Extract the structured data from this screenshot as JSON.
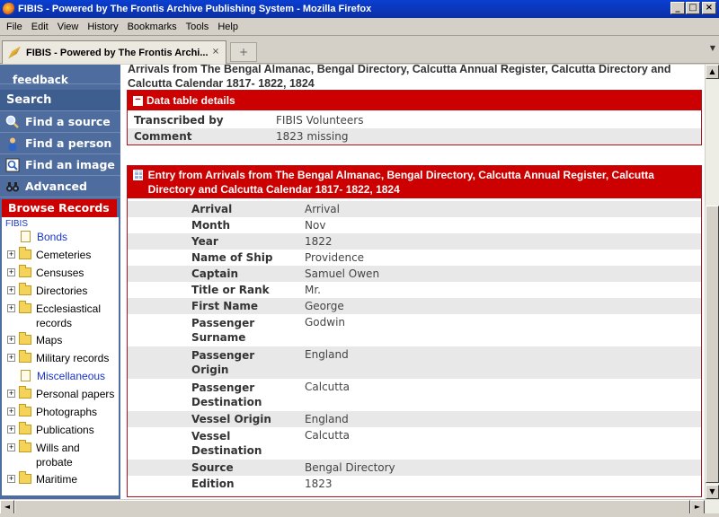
{
  "window": {
    "title": "FIBIS - Powered by The Frontis Archive Publishing System - Mozilla Firefox",
    "minimize": "_",
    "maximize": "□",
    "close": "×"
  },
  "menu": [
    "File",
    "Edit",
    "View",
    "History",
    "Bookmarks",
    "Tools",
    "Help"
  ],
  "tab": {
    "label": "FIBIS - Powered by The Frontis Archi...",
    "close": "×",
    "new_tab": "+"
  },
  "sidebar": {
    "top_item": "feedback",
    "search_head": "Search",
    "items": [
      {
        "label": "Find a source",
        "icon": "magnifier-icon"
      },
      {
        "label": "Find a person",
        "icon": "person-icon"
      },
      {
        "label": "Find an image",
        "icon": "image-icon"
      },
      {
        "label": "Advanced",
        "icon": "binoculars-icon"
      }
    ],
    "browse_head": "Browse Records",
    "tree_root": "FIBIS",
    "tree": [
      {
        "label": "Bonds",
        "type": "doc"
      },
      {
        "label": "Cemeteries",
        "type": "folder"
      },
      {
        "label": "Censuses",
        "type": "folder"
      },
      {
        "label": "Directories",
        "type": "folder"
      },
      {
        "label": "Ecclesiastical records",
        "type": "folder"
      },
      {
        "label": "Maps",
        "type": "folder"
      },
      {
        "label": "Military records",
        "type": "folder"
      },
      {
        "label": "Miscellaneous",
        "type": "doc"
      },
      {
        "label": "Personal papers",
        "type": "folder"
      },
      {
        "label": "Photographs",
        "type": "folder"
      },
      {
        "label": "Publications",
        "type": "folder"
      },
      {
        "label": "Wills and probate",
        "type": "folder"
      },
      {
        "label": "Maritime",
        "type": "folder"
      }
    ]
  },
  "main": {
    "title": "Arrivals from The Bengal Almanac, Bengal Directory, Calcutta Annual Register, Calcutta Directory and Calcutta Calendar 1817- 1822, 1824",
    "details": {
      "head": "Data table details",
      "toggle": "−",
      "rows": [
        {
          "k": "Transcribed by",
          "v": "FIBIS Volunteers"
        },
        {
          "k": "Comment",
          "v": "1823 missing"
        }
      ]
    },
    "entry": {
      "head": "Entry from Arrivals from The Bengal Almanac, Bengal Directory, Calcutta Annual Register, Calcutta Directory and Calcutta Calendar 1817- 1822, 1824",
      "rows": [
        {
          "k": "Arrival",
          "v": "Arrival"
        },
        {
          "k": "Month",
          "v": "Nov"
        },
        {
          "k": "Year",
          "v": "1822"
        },
        {
          "k": "Name of Ship",
          "v": "Providence"
        },
        {
          "k": "Captain",
          "v": "Samuel Owen"
        },
        {
          "k": "Title or Rank",
          "v": "Mr."
        },
        {
          "k": "First Name",
          "v": "George"
        },
        {
          "k": "Passenger Surname",
          "v": "Godwin"
        },
        {
          "k": "Passenger Origin",
          "v": "England"
        },
        {
          "k": "Passenger Destination",
          "v": "Calcutta"
        },
        {
          "k": "Vessel Origin",
          "v": "England"
        },
        {
          "k": "Vessel Destination",
          "v": "Calcutta"
        },
        {
          "k": "Source",
          "v": "Bengal Directory"
        },
        {
          "k": "Edition",
          "v": "1823"
        }
      ]
    }
  }
}
